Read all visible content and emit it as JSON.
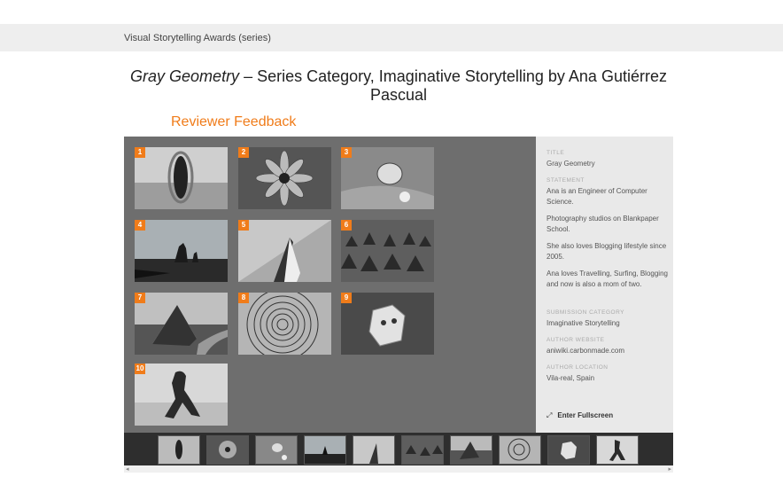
{
  "breadcrumb": "Visual Storytelling Awards (series)",
  "title": {
    "italic": "Gray Geometry",
    "rest": " – Series Category, Imaginative Storytelling by Ana Gutiérrez Pascual"
  },
  "feedback_link": "Reviewer Feedback",
  "photos": [
    {
      "num": "1",
      "icon": "rock-hole-photo"
    },
    {
      "num": "2",
      "icon": "flower-photo"
    },
    {
      "num": "3",
      "icon": "mushroom-photo"
    },
    {
      "num": "4",
      "icon": "sea-stacks-photo"
    },
    {
      "num": "5",
      "icon": "leaf-tip-photo"
    },
    {
      "num": "6",
      "icon": "sand-spikes-photo"
    },
    {
      "num": "7",
      "icon": "pyramid-photo"
    },
    {
      "num": "8",
      "icon": "tree-rings-photo"
    },
    {
      "num": "9",
      "icon": "stone-face-photo"
    },
    {
      "num": "10",
      "icon": "driftwood-photo"
    }
  ],
  "sidebar": {
    "title_label": "TITLE",
    "title_value": "Gray Geometry",
    "statement_label": "STATEMENT",
    "statement": [
      "Ana is an Engineer of Computer Science.",
      "Photography studios on Blankpaper School.",
      "She also loves Blogging lifestyle since 2005.",
      "Ana loves Travelling, Surfing, Blogging and now is also a mom of two."
    ],
    "category_label": "SUBMISSION CATEGORY",
    "category_value": "Imaginative Storytelling",
    "website_label": "AUTHOR WEBSITE",
    "website_value": "aniwiki.carbonmade.com",
    "location_label": "AUTHOR LOCATION",
    "location_value": "Vila-real, Spain",
    "fullscreen": "Enter Fullscreen"
  },
  "colors": {
    "accent": "#f07c1a",
    "gallery_bg": "#6e6e6e",
    "strip_bg": "#2e2e2e"
  }
}
